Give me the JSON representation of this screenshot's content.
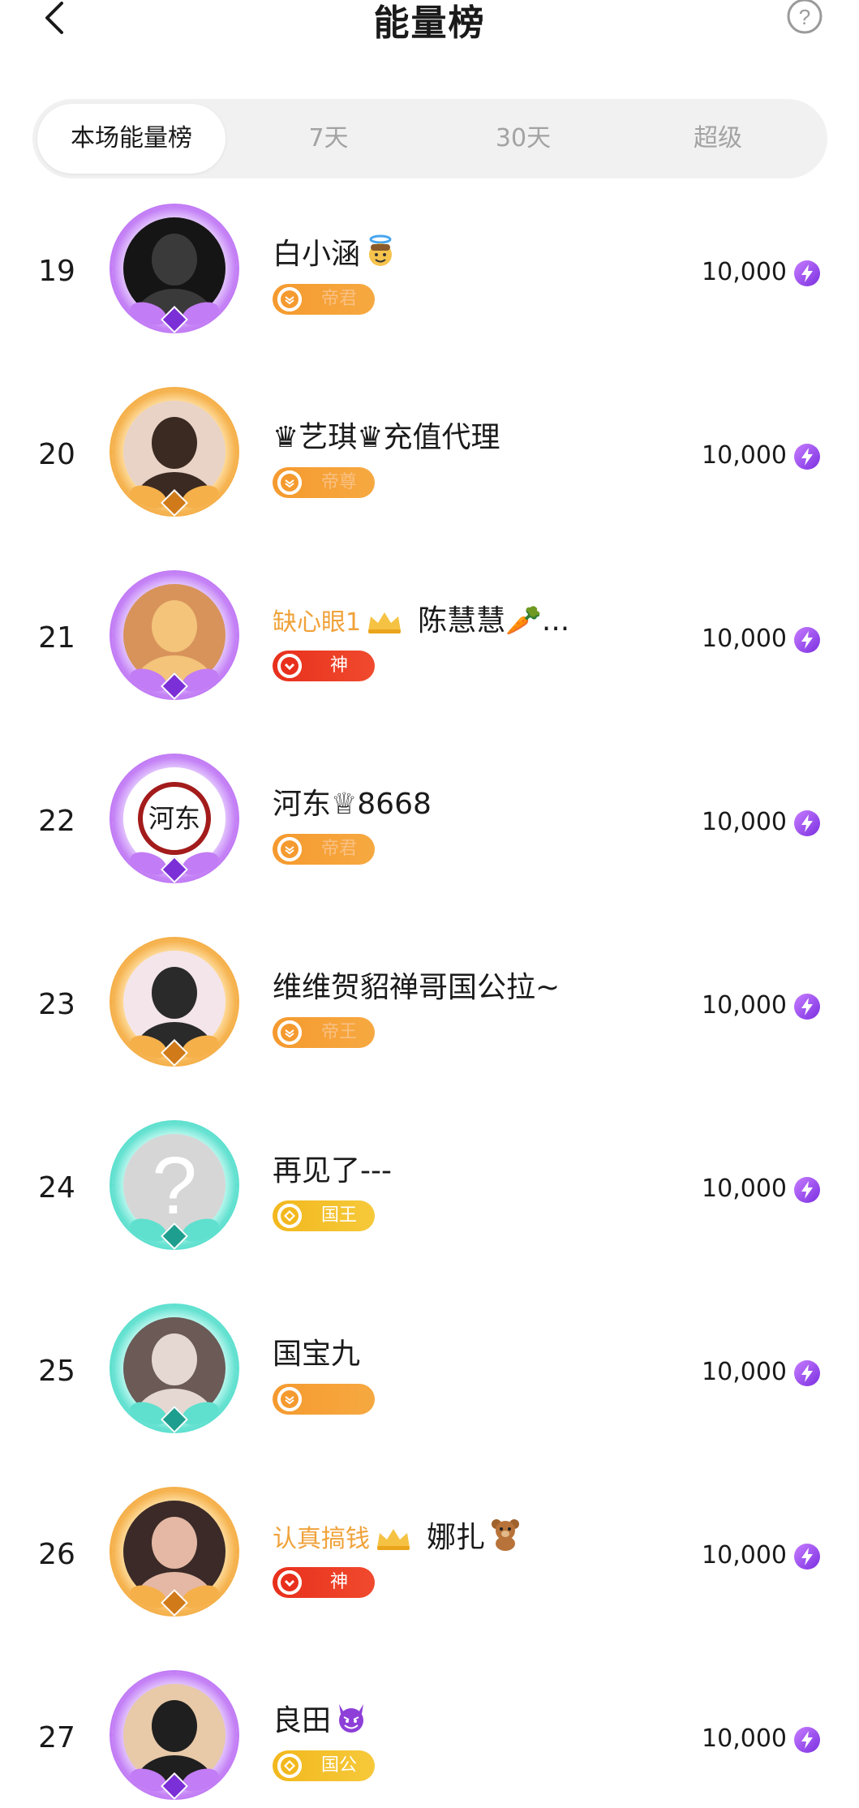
{
  "header": {
    "title": "能量榜"
  },
  "tabs": [
    {
      "label": "本场能量榜",
      "active": true
    },
    {
      "label": "7天",
      "active": false
    },
    {
      "label": "30天",
      "active": false
    },
    {
      "label": "超级",
      "active": false
    }
  ],
  "ranking": [
    {
      "rank": "19",
      "prefix": "",
      "name": "白小涵",
      "name_emoji": "angel-face-icon",
      "badge": "帝君",
      "badge_style": "orange",
      "frame": "purple",
      "score": "10,000"
    },
    {
      "rank": "20",
      "prefix": "",
      "name": "♛艺琪♛充值代理",
      "name_emoji": "",
      "badge": "帝尊",
      "badge_style": "orange",
      "frame": "gold",
      "score": "10,000"
    },
    {
      "rank": "21",
      "prefix": "缺心眼1",
      "name": "陈慧慧🥕...",
      "name_emoji": "",
      "badge": "神",
      "badge_style": "red",
      "frame": "purple",
      "score": "10,000"
    },
    {
      "rank": "22",
      "prefix": "",
      "name": "河东♕8668",
      "name_emoji": "",
      "badge": "帝君",
      "badge_style": "orange",
      "frame": "purple",
      "score": "10,000"
    },
    {
      "rank": "23",
      "prefix": "",
      "name": "维维贺貂禅哥国公拉~",
      "name_emoji": "",
      "badge": "帝王",
      "badge_style": "orange",
      "frame": "gold",
      "score": "10,000"
    },
    {
      "rank": "24",
      "prefix": "",
      "name": "再见了---",
      "name_emoji": "",
      "badge": "国王",
      "badge_style": "gold",
      "frame": "teal",
      "score": "10,000"
    },
    {
      "rank": "25",
      "prefix": "",
      "name": "国宝九",
      "name_emoji": "",
      "badge": "",
      "badge_style": "orange",
      "frame": "teal",
      "score": "10,000"
    },
    {
      "rank": "26",
      "prefix": "认真搞钱",
      "name": "娜扎",
      "name_emoji": "teddy-bear-icon",
      "badge": "神",
      "badge_style": "red",
      "frame": "gold",
      "score": "10,000"
    },
    {
      "rank": "27",
      "prefix": "",
      "name": "良田",
      "name_emoji": "devil-face-icon",
      "badge": "国公",
      "badge_style": "gold",
      "frame": "purple",
      "score": "10,000"
    }
  ],
  "colors": {
    "accent_orange": "#f59a2f",
    "accent_red": "#e8301c",
    "accent_gold": "#f2b81e",
    "energy_purple": "#9b4dff",
    "frame_purple": "#a24dea",
    "frame_gold": "#e8922a",
    "frame_teal": "#33c1b1",
    "prefix_gold": "#f0a23a"
  },
  "icons": {
    "back": "back-arrow-icon",
    "help": "help-question-icon",
    "energy": "energy-bolt-icon",
    "crown": "crown-icon"
  }
}
